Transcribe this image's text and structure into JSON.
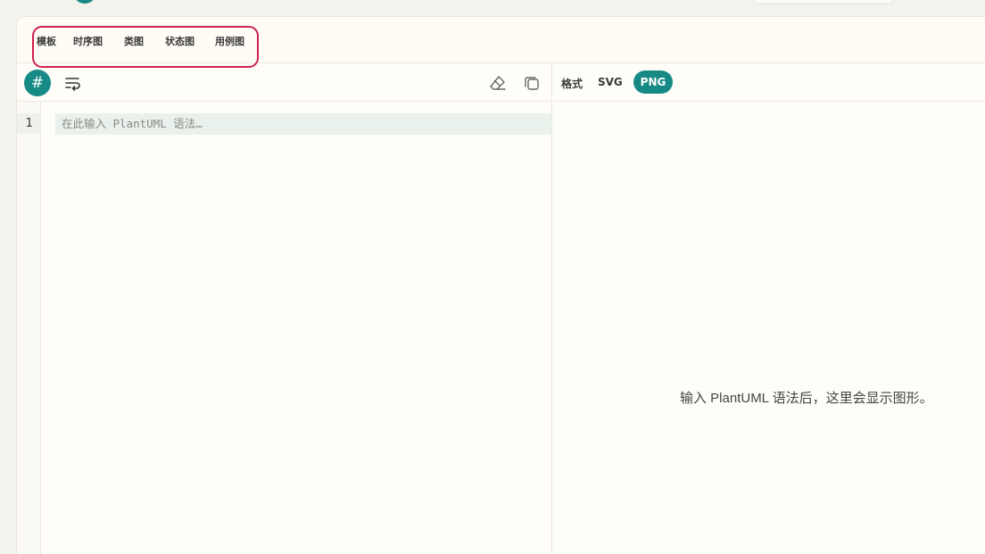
{
  "templates": {
    "label": "模板",
    "items": [
      "时序图",
      "类图",
      "状态图",
      "用例图"
    ]
  },
  "editor": {
    "line_numbers": [
      "1"
    ],
    "placeholder": "在此输入 PlantUML 语法…",
    "hash_symbol": "#"
  },
  "preview": {
    "format_label": "格式",
    "formats": [
      "SVG",
      "PNG"
    ],
    "selected_format": "PNG",
    "empty_message": "输入 PlantUML 语法后，这里会显示图形。"
  },
  "colors": {
    "accent": "#178a86",
    "highlight_border": "#d0204f",
    "background": "#fffdf8"
  }
}
